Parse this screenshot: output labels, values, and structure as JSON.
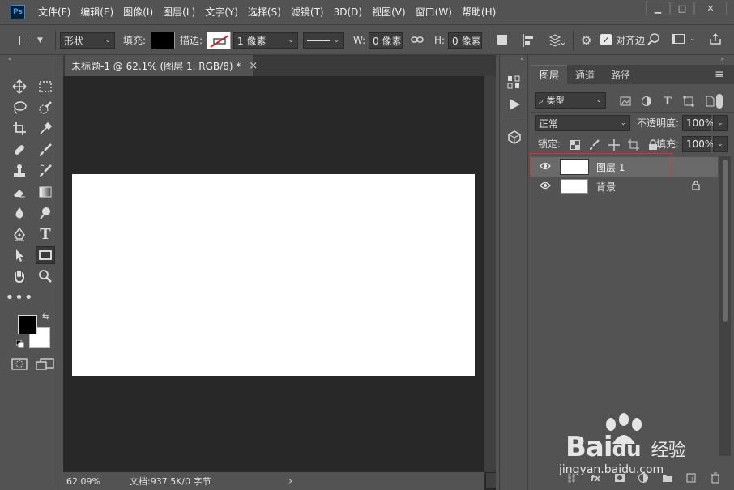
{
  "app": {
    "logo_text": "Ps"
  },
  "menu": [
    "文件(F)",
    "编辑(E)",
    "图像(I)",
    "图层(L)",
    "文字(Y)",
    "选择(S)",
    "滤镜(T)",
    "3D(D)",
    "视图(V)",
    "窗口(W)",
    "帮助(H)"
  ],
  "window_buttons": {
    "minimize": "▁",
    "restore": "□",
    "close": "✕"
  },
  "options": {
    "mode": "形状",
    "fill_label": "填充:",
    "stroke_label": "描边:",
    "stroke_width": "1 像素",
    "w_label": "W:",
    "w_value": "0 像素",
    "h_label": "H:",
    "h_value": "0 像素",
    "align_edges_label": "对齐边"
  },
  "document": {
    "tab_title": "未标题-1 @ 62.1% (图层 1, RGB/8) *",
    "tab_close": "×",
    "zoom": "62.09%",
    "doc_info": "文档:937.5K/0 字节",
    "status_arrow": "›"
  },
  "layers_panel": {
    "tabs": [
      "图层",
      "通道",
      "路径"
    ],
    "active_tab": "图层",
    "filter_kind": "类型",
    "blend_mode": "正常",
    "opacity_label": "不透明度:",
    "opacity_value": "100%",
    "lock_label": "锁定:",
    "fill_label": "填充:",
    "fill_value": "100%",
    "layers": [
      {
        "name": "图层 1",
        "selected": true,
        "locked": false
      },
      {
        "name": "背景",
        "selected": false,
        "locked": true
      }
    ]
  },
  "colors": {
    "foreground": "#000000",
    "background": "#ffffff",
    "highlight_border": "#e03030"
  },
  "watermark": {
    "brand_left": "Bai",
    "brand_right": "du",
    "tagline": "经验",
    "url": "jingyan.baidu.com"
  }
}
